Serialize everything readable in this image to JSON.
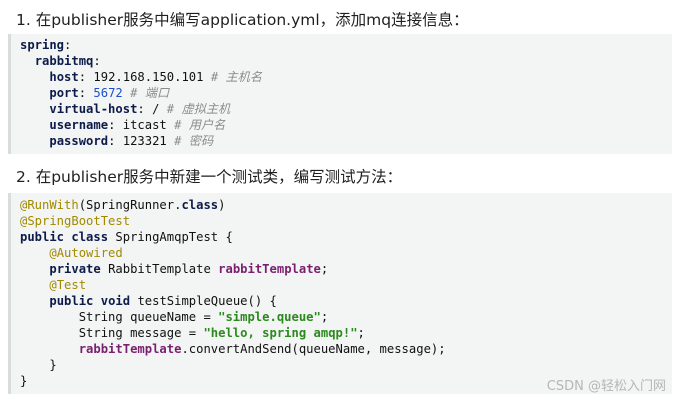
{
  "step1": {
    "text": "1.  在publisher服务中编写application.yml，添加mq连接信息："
  },
  "yaml": {
    "root_key": "spring",
    "rabbitmq_key": "rabbitmq",
    "host_key": "host",
    "host_val": "192.168.150.101",
    "host_comment": "# 主机名",
    "port_key": "port",
    "port_val": "5672",
    "port_comment": "# 端口",
    "vhost_key": "virtual-host",
    "vhost_val": "/",
    "vhost_comment": "# 虚拟主机",
    "user_key": "username",
    "user_val": "itcast",
    "user_comment": "# 用户名",
    "pass_key": "password",
    "pass_val": "123321",
    "pass_comment": "# 密码"
  },
  "step2": {
    "text": "2.  在publisher服务中新建一个测试类，编写测试方法："
  },
  "java": {
    "l1_ann": "@RunWith",
    "l1_rest": "(SpringRunner.",
    "l1_kw": "class",
    "l1_end": ")",
    "l2_ann": "@SpringBootTest",
    "l3_kw1": "public",
    "l3_kw2": "class",
    "l3_rest": "SpringAmqpTest {",
    "l4_ann": "@Autowired",
    "l5_kw": "private",
    "l5_type": "RabbitTemplate",
    "l5_field": "rabbitTemplate",
    "l5_end": ";",
    "l6_ann": "@Test",
    "l7_kw1": "public",
    "l7_kw2": "void",
    "l7_rest": "testSimpleQueue() {",
    "l8_decl": "String queueName = ",
    "l8_str": "\"simple.queue\"",
    "l8_end": ";",
    "l9_decl": "String message = ",
    "l9_str": "\"hello, spring amqp!\"",
    "l9_end": ";",
    "l10_field": "rabbitTemplate",
    "l10_rest": ".convertAndSend(queueName, message);",
    "l11": "}",
    "l12": "}"
  },
  "watermark": "CSDN @轻松入门网"
}
